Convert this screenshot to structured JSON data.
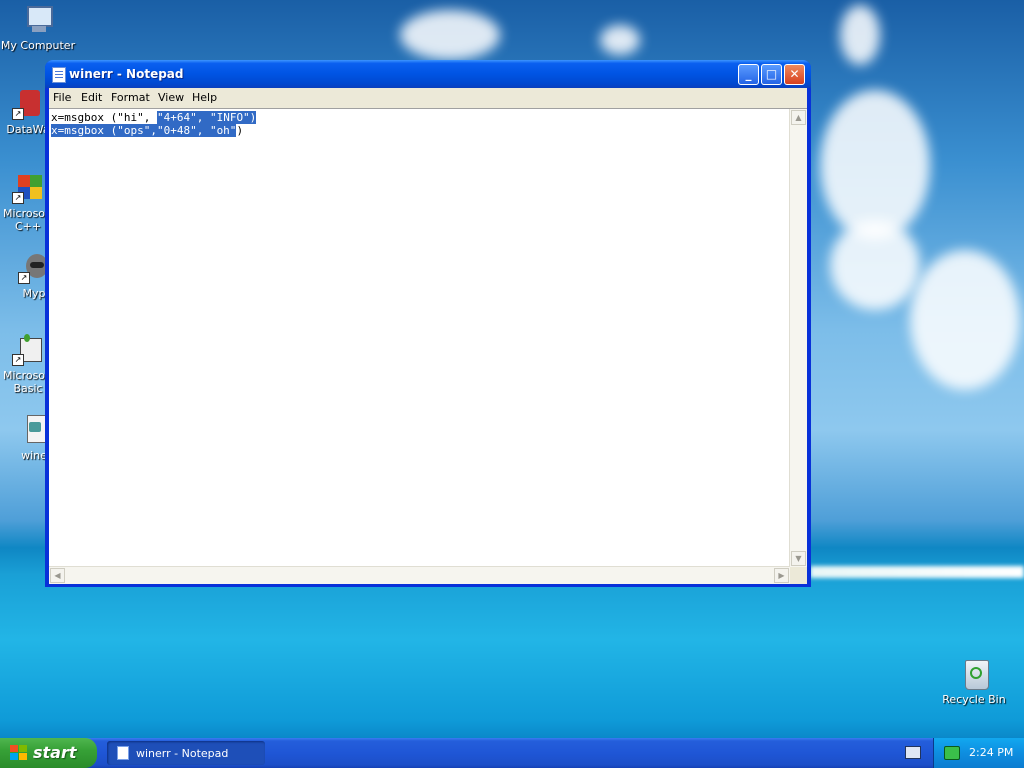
{
  "desktop": {
    "icons": [
      {
        "label": "My Computer"
      },
      {
        "label": "DataWa"
      },
      {
        "label": "Microsoft\nC++"
      },
      {
        "label": "Myp"
      },
      {
        "label": "Microsoft\nBasic"
      },
      {
        "label": "wine"
      },
      {
        "label": "Recycle Bin"
      }
    ]
  },
  "window": {
    "title": "winerr - Notepad",
    "controls": {
      "minimize": "_",
      "maximize": "□",
      "close": "✕"
    },
    "menu": [
      "File",
      "Edit",
      "Format",
      "View",
      "Help"
    ],
    "content": {
      "line1_plain": "x=msgbox (\"hi\", ",
      "line1_selected": "\"4+64\", \"INFO\")",
      "line2_selected": "x=msgbox (\"ops\",\"0+48\", \"oh\"",
      "line2_plain": ")"
    }
  },
  "taskbar": {
    "start_label": "start",
    "tasks": [
      {
        "label": "winerr - Notepad"
      }
    ],
    "clock": "2:24 PM"
  },
  "colors": {
    "selection": "#316ac5",
    "titlebar": "#0054e3",
    "taskbar": "#245edb",
    "start": "#37a137"
  }
}
